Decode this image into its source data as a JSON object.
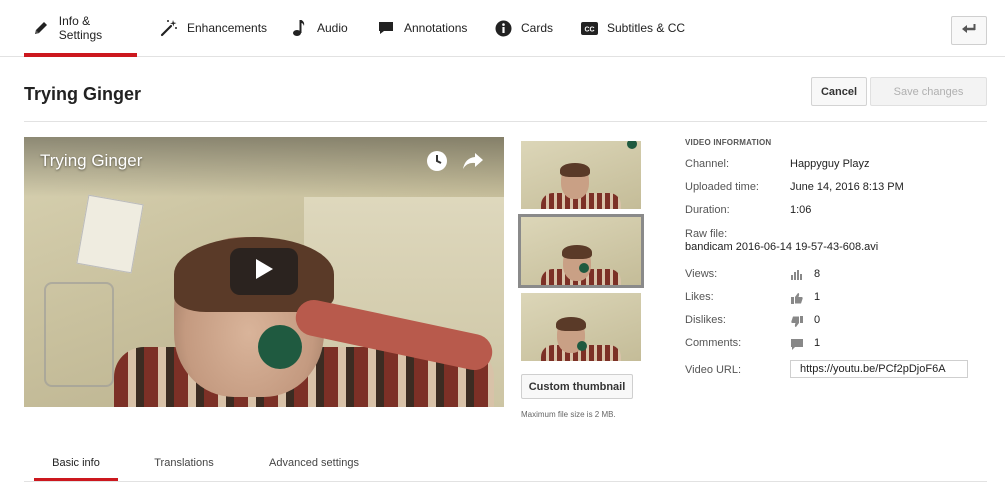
{
  "tabs": [
    {
      "label": "Info & Settings",
      "icon": "pencil-icon",
      "active": true
    },
    {
      "label": "Enhancements",
      "icon": "magic-wand-icon",
      "active": false
    },
    {
      "label": "Audio",
      "icon": "music-note-icon",
      "active": false
    },
    {
      "label": "Annotations",
      "icon": "speech-bubble-icon",
      "active": false
    },
    {
      "label": "Cards",
      "icon": "info-circle-icon",
      "active": false
    },
    {
      "label": "Subtitles & CC",
      "icon": "cc-icon",
      "active": false
    }
  ],
  "header": {
    "title": "Trying Ginger",
    "cancel_label": "Cancel",
    "save_label": "Save changes"
  },
  "player": {
    "title": "Trying Ginger",
    "icons": [
      "watch-later-icon",
      "share-icon",
      "play-icon"
    ]
  },
  "thumbnails": {
    "count": 3,
    "selected_index": 1,
    "custom_button_label": "Custom thumbnail",
    "max_size_note": "Maximum file size is 2 MB."
  },
  "video_info": {
    "heading": "VIDEO INFORMATION",
    "channel_label": "Channel:",
    "channel": "Happyguy Playz",
    "uploaded_label": "Uploaded time:",
    "uploaded": "June 14, 2016 8:13 PM",
    "duration_label": "Duration:",
    "duration": "1:06",
    "raw_file_label": "Raw file:",
    "raw_file": "bandicam 2016-06-14 19-57-43-608.avi",
    "views_label": "Views:",
    "views": "8",
    "likes_label": "Likes:",
    "likes": "1",
    "dislikes_label": "Dislikes:",
    "dislikes": "0",
    "comments_label": "Comments:",
    "comments": "1",
    "url_label": "Video URL:",
    "url": "https://youtu.be/PCf2pDjoF6A"
  },
  "bottom_tabs": [
    {
      "label": "Basic info",
      "active": true
    },
    {
      "label": "Translations",
      "active": false
    },
    {
      "label": "Advanced settings",
      "active": false
    }
  ],
  "colors": {
    "accent_red": "#cc181e",
    "border": "#e2e2e2"
  }
}
